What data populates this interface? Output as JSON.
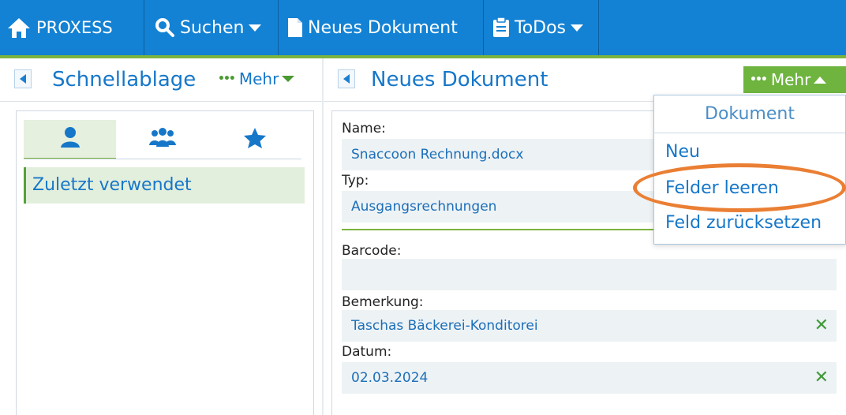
{
  "topbar": {
    "home_label": "PROXESS",
    "search_label": "Suchen",
    "new_doc_label": "Neues Dokument",
    "todos_label": "ToDos"
  },
  "left_panel": {
    "title": "Schnellablage",
    "more_label": "Mehr",
    "tabs": [
      "person",
      "group",
      "favorites"
    ],
    "recent_label": "Zuletzt verwendet"
  },
  "right_panel": {
    "title": "Neues Dokument",
    "more_label": "Mehr",
    "fields": {
      "name_label": "Name:",
      "name_value": "Snaccoon Rechnung.docx",
      "type_label": "Typ:",
      "type_value": "Ausgangsrechnungen",
      "barcode_label": "Barcode:",
      "barcode_value": "",
      "remark_label": "Bemerkung:",
      "remark_value": "Taschas Bäckerei-Konditorei",
      "date_label": "Datum:",
      "date_value": "02.03.2024"
    }
  },
  "dropdown": {
    "header": "Dokument",
    "items": [
      "Neu",
      "Felder leeren",
      "Feld zurücksetzen"
    ]
  },
  "colors": {
    "topbar": "#1382d4",
    "accent_green": "#6eb43f",
    "link_blue": "#1677c9",
    "highlight_orange": "#ea7f34"
  }
}
